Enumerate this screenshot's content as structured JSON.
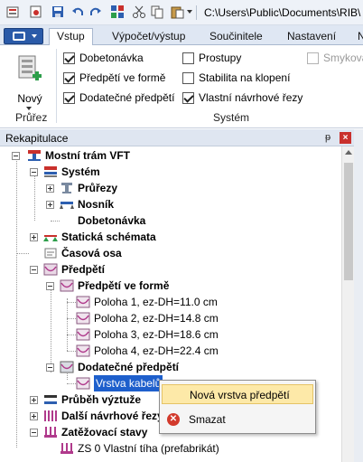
{
  "qat": {
    "path": "C:\\Users\\Public\\Documents\\RIB\\"
  },
  "ribbon_tabs": [
    "Vstup",
    "Výpočet/výstup",
    "Součinitele",
    "Nastavení",
    "N"
  ],
  "ribbon": {
    "new_label": "Nový",
    "group_prurez": "Průřez",
    "group_system": "Systém",
    "checks": [
      {
        "label": "Dobetonávka",
        "checked": true
      },
      {
        "label": "Předpětí ve formě",
        "checked": true
      },
      {
        "label": "Dodatečné předpětí",
        "checked": true
      },
      {
        "label": "Prostupy",
        "checked": false
      },
      {
        "label": "Stabilita na klopení",
        "checked": false
      },
      {
        "label": "Vlastní návrhové řezy",
        "checked": true
      },
      {
        "label": "Smyková",
        "checked": false,
        "disabled": true
      }
    ]
  },
  "panel": {
    "title": "Rekapitulace",
    "pin": "ᵽ",
    "close": "×"
  },
  "tree": {
    "root": "Mostní trám VFT",
    "system": "Systém",
    "prurezy": "Průřezy",
    "nosnik": "Nosník",
    "dobetonavka": "Dobetonávka",
    "staticka": "Statická schémata",
    "casova": "Časová osa",
    "predpeti": "Předpětí",
    "predpeti_forme": "Předpětí ve formě",
    "poloha1": "Poloha 1, ez-DH=11.0 cm",
    "poloha2": "Poloha 2, ez-DH=14.8 cm",
    "poloha3": "Poloha 3, ez-DH=18.6 cm",
    "poloha4": "Poloha 4, ez-DH=22.4 cm",
    "dodatecne": "Dodatečné předpětí",
    "vrstva": "Vrstva kabelů",
    "prubeh": "Průběh výztuže",
    "dalsi": "Další návrhové řezy",
    "zatezovaci": "Zatěžovací stavy",
    "zs0": "ZS 0 Vlastní tíha (prefabrikát)"
  },
  "context_menu": {
    "item1": "Nová vrstva předpětí",
    "item2": "Smazat"
  }
}
